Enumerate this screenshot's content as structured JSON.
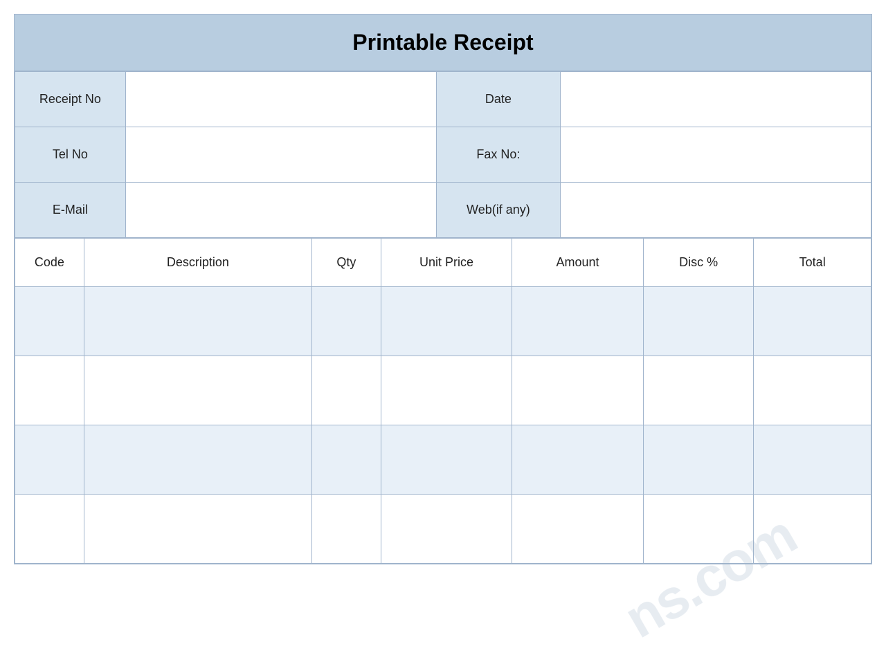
{
  "header": {
    "title": "Printable Receipt"
  },
  "info_rows": [
    {
      "label1": "Receipt No",
      "value1": "",
      "label2": "Date",
      "value2": ""
    },
    {
      "label1": "Tel No",
      "value1": "",
      "label2": "Fax No:",
      "value2": ""
    },
    {
      "label1": "E-Mail",
      "value1": "",
      "label2": "Web(if any)",
      "value2": ""
    }
  ],
  "table_headers": {
    "code": "Code",
    "description": "Description",
    "qty": "Qty",
    "unit_price": "Unit Price",
    "amount": "Amount",
    "disc": "Disc %",
    "total": "Total"
  },
  "empty_rows": 4,
  "watermark": "ns.com"
}
